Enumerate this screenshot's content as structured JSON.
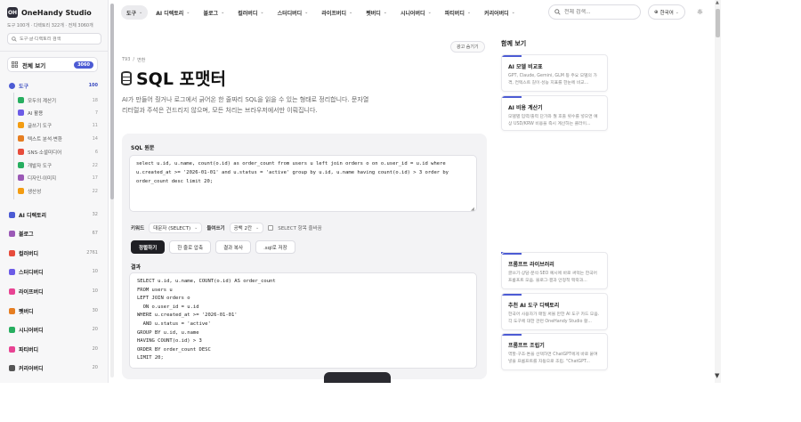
{
  "brand": {
    "logo_text": "OH",
    "name": "OneHandy Studio"
  },
  "stats": "도구 100개 · 디렉토리 322개 · 전체 3060개",
  "side_search": {
    "placeholder": "도구·글·디렉토리 검색"
  },
  "all_view": {
    "label": "전체 보기",
    "count": "3060"
  },
  "categories": [
    {
      "name": "도구",
      "count": "100",
      "color": "#4c5bd4"
    },
    {
      "name": "AI 디렉토리",
      "count": "32",
      "color": "#4c5bd4"
    },
    {
      "name": "블로그",
      "count": "67",
      "color": "#9b59b6"
    },
    {
      "name": "컬러버디",
      "count": "2761",
      "color": "#e74c3c"
    },
    {
      "name": "스터디버디",
      "count": "10",
      "color": "#6c5ce7"
    },
    {
      "name": "라이프버디",
      "count": "10",
      "color": "#e84393"
    },
    {
      "name": "펫버디",
      "count": "30",
      "color": "#e67e22"
    },
    {
      "name": "시니어버디",
      "count": "20",
      "color": "#27ae60"
    },
    {
      "name": "파티버디",
      "count": "20",
      "color": "#e84393"
    },
    {
      "name": "커리어버디",
      "count": "20",
      "color": "#555555"
    }
  ],
  "subcats": [
    {
      "name": "모두의 계산기",
      "count": "18",
      "color": "#27ae60"
    },
    {
      "name": "AI 활용",
      "count": "7",
      "color": "#6c5ce7"
    },
    {
      "name": "글쓰기 도구",
      "count": "11",
      "color": "#f39c12"
    },
    {
      "name": "텍스트 분석·변환",
      "count": "14",
      "color": "#e67e22"
    },
    {
      "name": "SNS·소셜미디어",
      "count": "6",
      "color": "#e74c3c"
    },
    {
      "name": "개발자 도구",
      "count": "22",
      "color": "#27ae60"
    },
    {
      "name": "디자인·이미지",
      "count": "17",
      "color": "#9b59b6"
    },
    {
      "name": "생산성",
      "count": "22",
      "color": "#f39c12"
    }
  ],
  "nav": [
    {
      "label": "도구",
      "active": true
    },
    {
      "label": "AI 디렉토리"
    },
    {
      "label": "블로그"
    },
    {
      "label": "컬러버디"
    },
    {
      "label": "스터디버디"
    },
    {
      "label": "라이프버디"
    },
    {
      "label": "펫버디"
    },
    {
      "label": "시니어버디"
    },
    {
      "label": "파티버디"
    },
    {
      "label": "커리어버디"
    }
  ],
  "top_search": {
    "placeholder": "전체 검색..."
  },
  "lang": "한국어",
  "breadcrumb": {
    "home": "T93",
    "sep": "/",
    "current": "변환"
  },
  "hide_ads": "광고 숨기기",
  "page_title": "SQL 포맷터",
  "description": "AI가 만들어 줬거나 로그에서 긁어온 한 줄짜리 SQL을 읽을 수 있는 형태로 정리합니다. 문자열 리터럴과 주석은 건드리지 않으며, 모든 처리는 브라우저에서만 이뤄집니다.",
  "sql_input": {
    "label": "SQL 원문",
    "value": "select u.id, u.name, count(o.id) as order_count from users u left join orders o on o.user_id = u.id where u.created_at >= '2026-01-01' and u.status = 'active' group by u.id, u.name having count(o.id) > 3 order by order_count desc limit 20;"
  },
  "options": {
    "keyword_label": "키워드",
    "keyword_value": "대문자 (SELECT)",
    "indent_label": "들여쓰기",
    "indent_value": "공백 2칸",
    "checkbox_label": "SELECT 항목 줄바꿈"
  },
  "buttons": {
    "format": "정렬하기",
    "minify": "한 줄로 압축",
    "copy": "결과 복사",
    "save": ".sql로 저장"
  },
  "result": {
    "label": "결과",
    "lines": [
      "SELECT u.id, u.name, COUNT(o.id) AS order_count",
      "FROM users u",
      "LEFT JOIN orders o",
      "  ON o.user_id = u.id",
      "WHERE u.created_at >= '2026-01-01'",
      "  AND u.status = 'active'",
      "GROUP BY u.id, u.name",
      "HAVING COUNT(o.id) > 3",
      "ORDER BY order_count DESC",
      "LIMIT 20;"
    ]
  },
  "related": {
    "title": "함께 보기",
    "cards": [
      {
        "title": "AI 모델 비교표",
        "desc": "GPT, Claude, Gemini, GLM 등 주요 모델의 가격, 컨텍스트 길이·성능 지표를 한눈에 비교..."
      },
      {
        "title": "AI 비용 계산기",
        "desc": "모델별 입력/출력 단가와 월 호출 횟수를 넣으면 예상 USD/KRW 비용을 즉시 계산하는 클라이..."
      },
      {
        "title": "프롬프트 라이브러리",
        "desc": "글쓰기·상담·분석·SEO 예시에 바로 써먹는 한국어 프롬프트 모음. 블로그·결과 안정적 맥락과..."
      },
      {
        "title": "추천 AI 도구 디렉토리",
        "desc": "한국어 사용자가 매일 써볼 만한 AI 도구 카드 모음. 각 도구에 대한 관련 OneHandy Studio 활..."
      },
      {
        "title": "프롬프트 조립기",
        "desc": "역할·구조·톤을 선택하면 ChatGPT에게 바로 붙여넣을 프롬프트를 자동으로 조립. \"ChatGPT..."
      }
    ]
  }
}
